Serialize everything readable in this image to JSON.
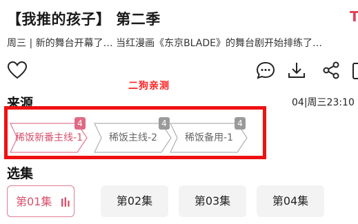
{
  "header": {
    "title": "【我推的孩子】 第二季",
    "corner_glyph": "T",
    "description": "周三 | 新的舞台开幕了… 当红漫画《东京BLADE》的舞台剧开始排练了…"
  },
  "actions": [
    {
      "icon": "heart-icon"
    },
    {
      "icon": "comment-icon"
    },
    {
      "icon": "download-icon"
    },
    {
      "icon": "share-icon"
    },
    {
      "icon": "more-icon"
    }
  ],
  "watermark": "二狗亲测",
  "source_section": {
    "heading": "来源",
    "airtime": "04|周三23:10",
    "routes": [
      {
        "label": "稀饭新番主线-1",
        "badge": "4",
        "active": true
      },
      {
        "label": "稀饭主线-2",
        "badge": "4",
        "active": false
      },
      {
        "label": "稀饭备用-1",
        "badge": "4",
        "active": false
      }
    ]
  },
  "episode_section": {
    "heading": "选集",
    "episodes": [
      {
        "label": "第01集",
        "active": true
      },
      {
        "label": "第02集",
        "active": false
      },
      {
        "label": "第03集",
        "active": false
      },
      {
        "label": "第04集",
        "active": false
      }
    ]
  },
  "colors": {
    "accent": "#d94f6c",
    "highlight_box": "#ee1111",
    "badge_gray": "#9a9a9a",
    "badge_active": "#e06a84"
  }
}
